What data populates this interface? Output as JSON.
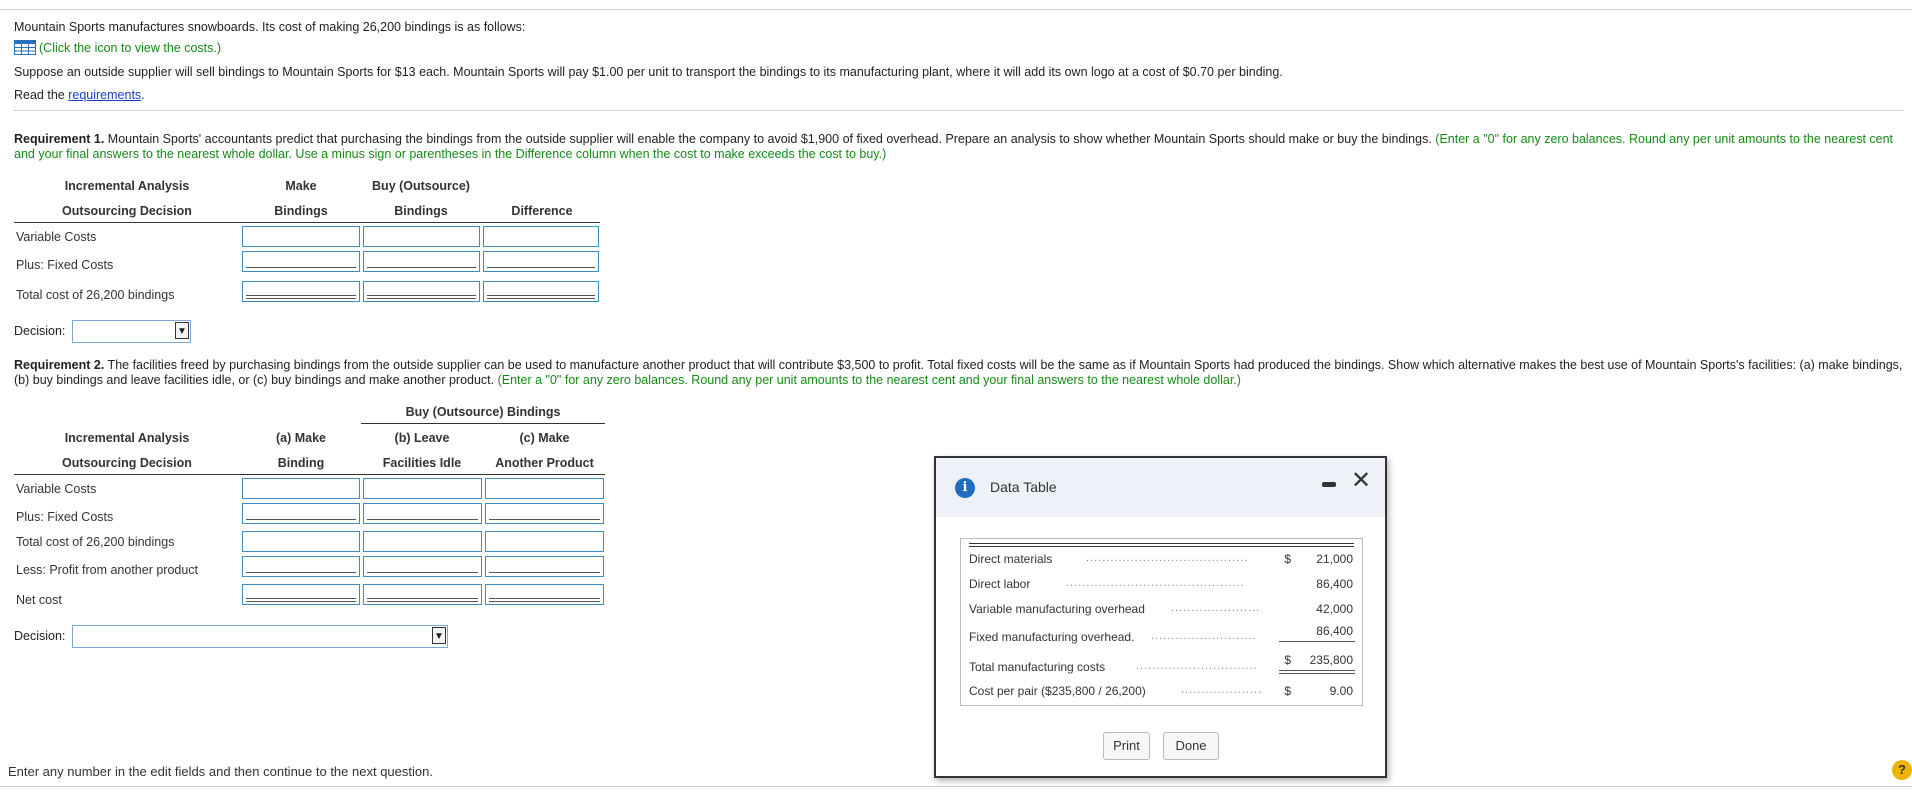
{
  "intro": {
    "line1": "Mountain Sports manufactures snowboards. Its cost of making 26,200 bindings is as follows:",
    "costs_link": "(Click the icon to view the costs.)",
    "line2": "Suppose an outside supplier will sell bindings to Mountain Sports for $13 each. Mountain Sports will pay $1.00 per unit to transport the bindings to its manufacturing plant, where it will add its own logo at a cost of $0.70 per binding.",
    "read_prefix": "Read the ",
    "requirements_link": "requirements",
    "read_suffix": "."
  },
  "req1": {
    "label": "Requirement 1.",
    "text": " Mountain Sports' accountants predict that purchasing the bindings from the outside supplier will enable the company to avoid $1,900 of fixed overhead. Prepare an analysis to show whether Mountain Sports should make or buy the bindings. ",
    "instructions": "(Enter a \"0\" for any zero balances. Round any per unit amounts to the nearest cent and your final answers to the nearest whole dollar. Use a minus sign or parentheses in the Difference column when the cost to make exceeds the cost to buy.)",
    "table": {
      "header_left_1": "Incremental Analysis",
      "header_left_2": "Outsourcing Decision",
      "col1_1": "Make",
      "col1_2": "Bindings",
      "col2_1": "Buy (Outsource)",
      "col2_2": "Bindings",
      "col3_2": "Difference",
      "rows": [
        "Variable Costs",
        "Plus: Fixed Costs",
        "Total cost of 26,200 bindings"
      ]
    },
    "decision_label": "Decision:"
  },
  "req2": {
    "label": "Requirement 2.",
    "text": " The facilities freed by purchasing bindings from the outside supplier can be used to manufacture another product that will contribute $3,500 to profit. Total fixed costs will be the same as if Mountain Sports had produced the bindings. Show which alternative makes the best use of Mountain Sports's facilities: (a) make bindings, (b) buy bindings and leave facilities idle, or (c) buy bindings and make another product. ",
    "instructions": "(Enter a \"0\" for any zero balances. Round any per unit amounts to the nearest cent and your final answers to the nearest whole dollar.)",
    "table": {
      "group_header": "Buy (Outsource) Bindings",
      "header_left_1": "Incremental Analysis",
      "header_left_2": "Outsourcing Decision",
      "col1_1": "(a) Make",
      "col1_2": "Binding",
      "col2_1": "(b) Leave",
      "col2_2": "Facilities Idle",
      "col3_1": "(c) Make",
      "col3_2": "Another Product",
      "rows": [
        "Variable Costs",
        "Plus: Fixed Costs",
        "Total cost of 26,200 bindings",
        "Less: Profit from another product",
        "Net cost"
      ]
    },
    "decision_label": "Decision:"
  },
  "footer_text": "Enter any number in the edit fields and then continue to the next question.",
  "dialog": {
    "title": "Data Table",
    "rows": [
      {
        "label": "Direct materials",
        "dollar": "$",
        "value": "21,000"
      },
      {
        "label": "Direct labor",
        "dollar": "",
        "value": "86,400"
      },
      {
        "label": "Variable manufacturing overhead",
        "dollar": "",
        "value": "42,000"
      },
      {
        "label": "Fixed manufacturing overhead.",
        "dollar": "",
        "value": "86,400"
      },
      {
        "label": "Total manufacturing costs",
        "dollar": "$",
        "value": "235,800"
      },
      {
        "label": "Cost per pair ($235,800 / 26,200)",
        "dollar": "$",
        "value": "9.00"
      }
    ],
    "print_label": "Print",
    "done_label": "Done"
  },
  "help_label": "?",
  "icons": [
    "table-icon",
    "dropdown-arrow-icon",
    "info-icon",
    "minimize-icon",
    "close-icon",
    "help-icon"
  ]
}
